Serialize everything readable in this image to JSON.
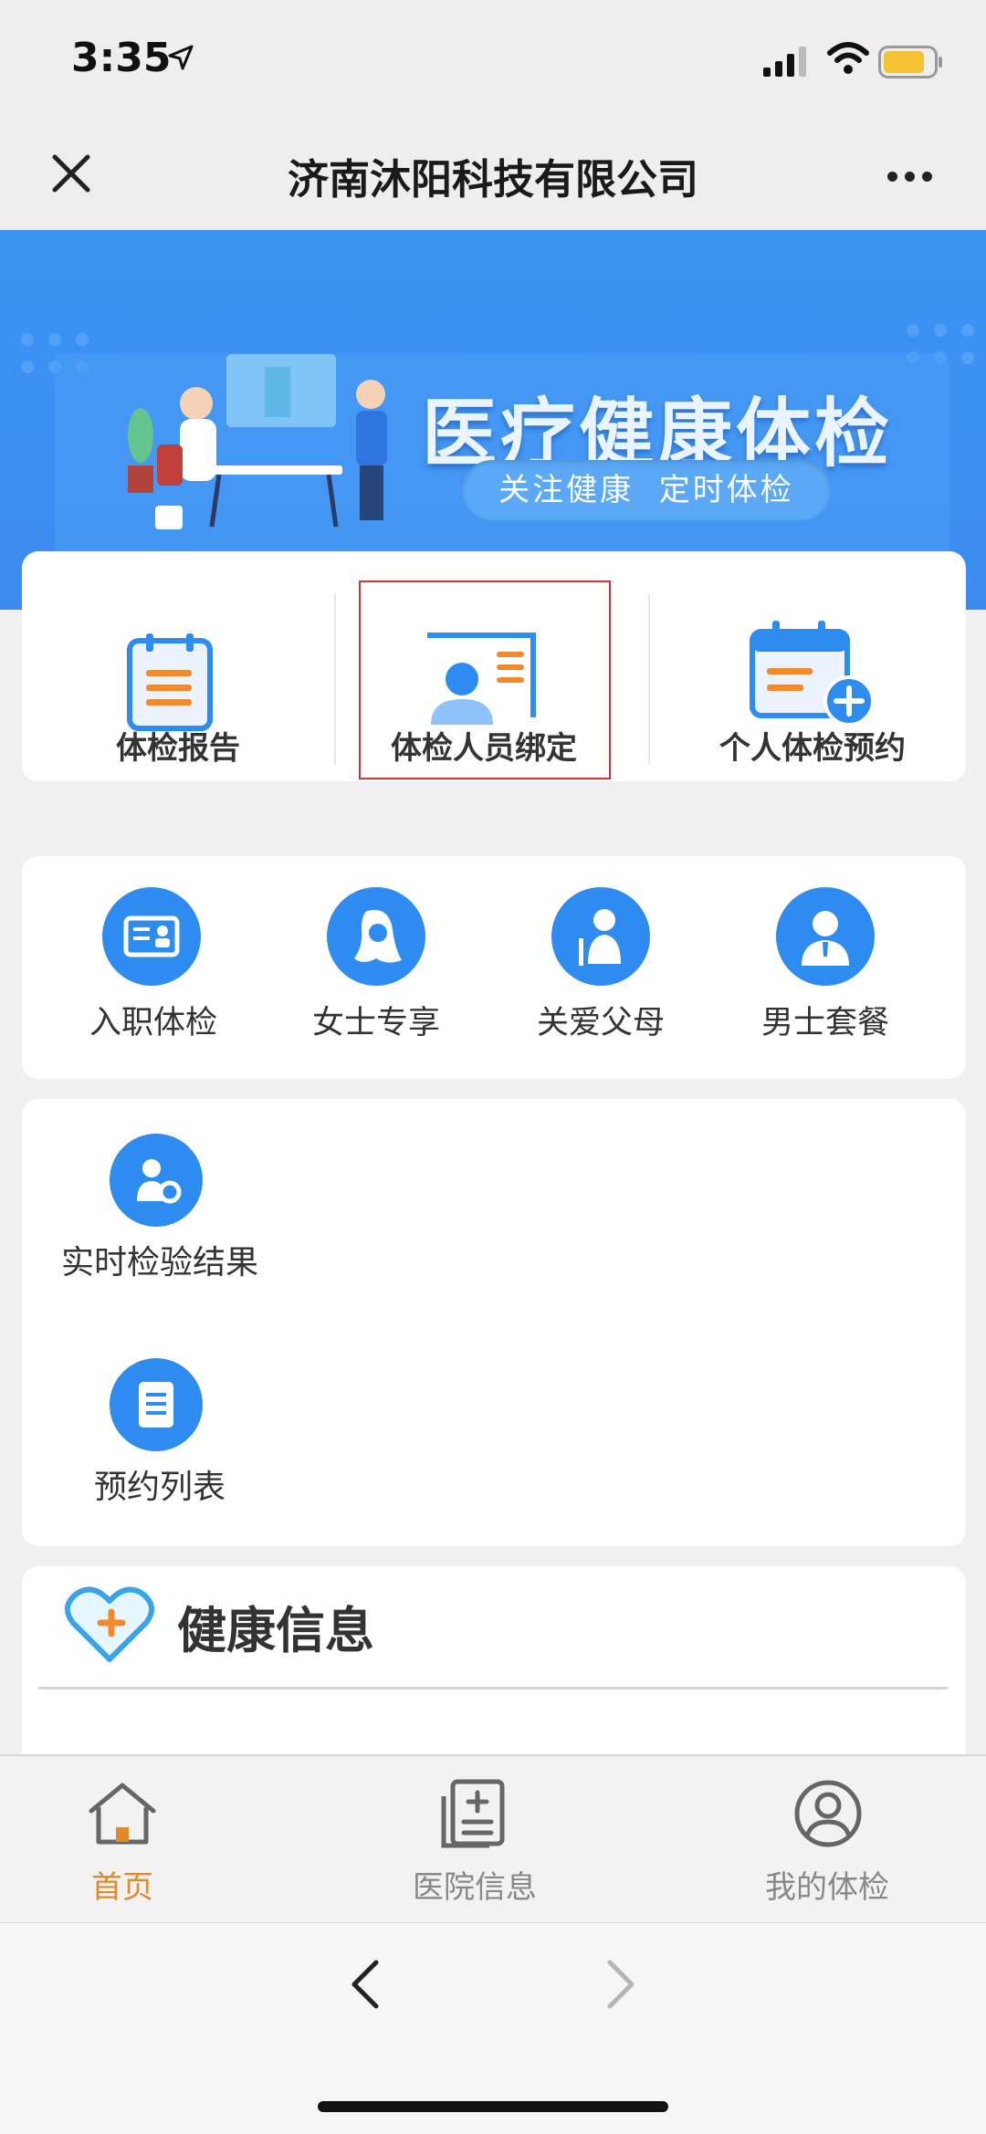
{
  "status_bar": {
    "time": "3:35"
  },
  "nav": {
    "title": "济南沐阳科技有限公司"
  },
  "banner": {
    "title": "医疗健康体检",
    "subtitle": "关注健康  定时体检"
  },
  "main_actions": [
    {
      "label": "体检报告",
      "icon": "report-clipboard-icon"
    },
    {
      "label": "体检人员绑定",
      "icon": "person-card-icon"
    },
    {
      "label": "个人体检预约",
      "icon": "calendar-add-icon"
    }
  ],
  "packages": [
    {
      "label": "入职体检",
      "icon": "id-card-icon"
    },
    {
      "label": "女士专享",
      "icon": "woman-icon"
    },
    {
      "label": "关爱父母",
      "icon": "elderly-icon"
    },
    {
      "label": "男士套餐",
      "icon": "man-icon"
    }
  ],
  "services": [
    {
      "label": "实时检验结果",
      "icon": "test-result-icon"
    },
    {
      "label": "预约列表",
      "icon": "list-icon"
    }
  ],
  "health_info": {
    "title": "健康信息"
  },
  "tabs": [
    {
      "label": "首页",
      "active": true
    },
    {
      "label": "医院信息",
      "active": false
    },
    {
      "label": "我的体检",
      "active": false
    }
  ],
  "colors": {
    "accent": "#e08a2c",
    "primary": "#2e8bf0",
    "banner": "#3c95f3",
    "highlight_box": "#d9302c"
  }
}
